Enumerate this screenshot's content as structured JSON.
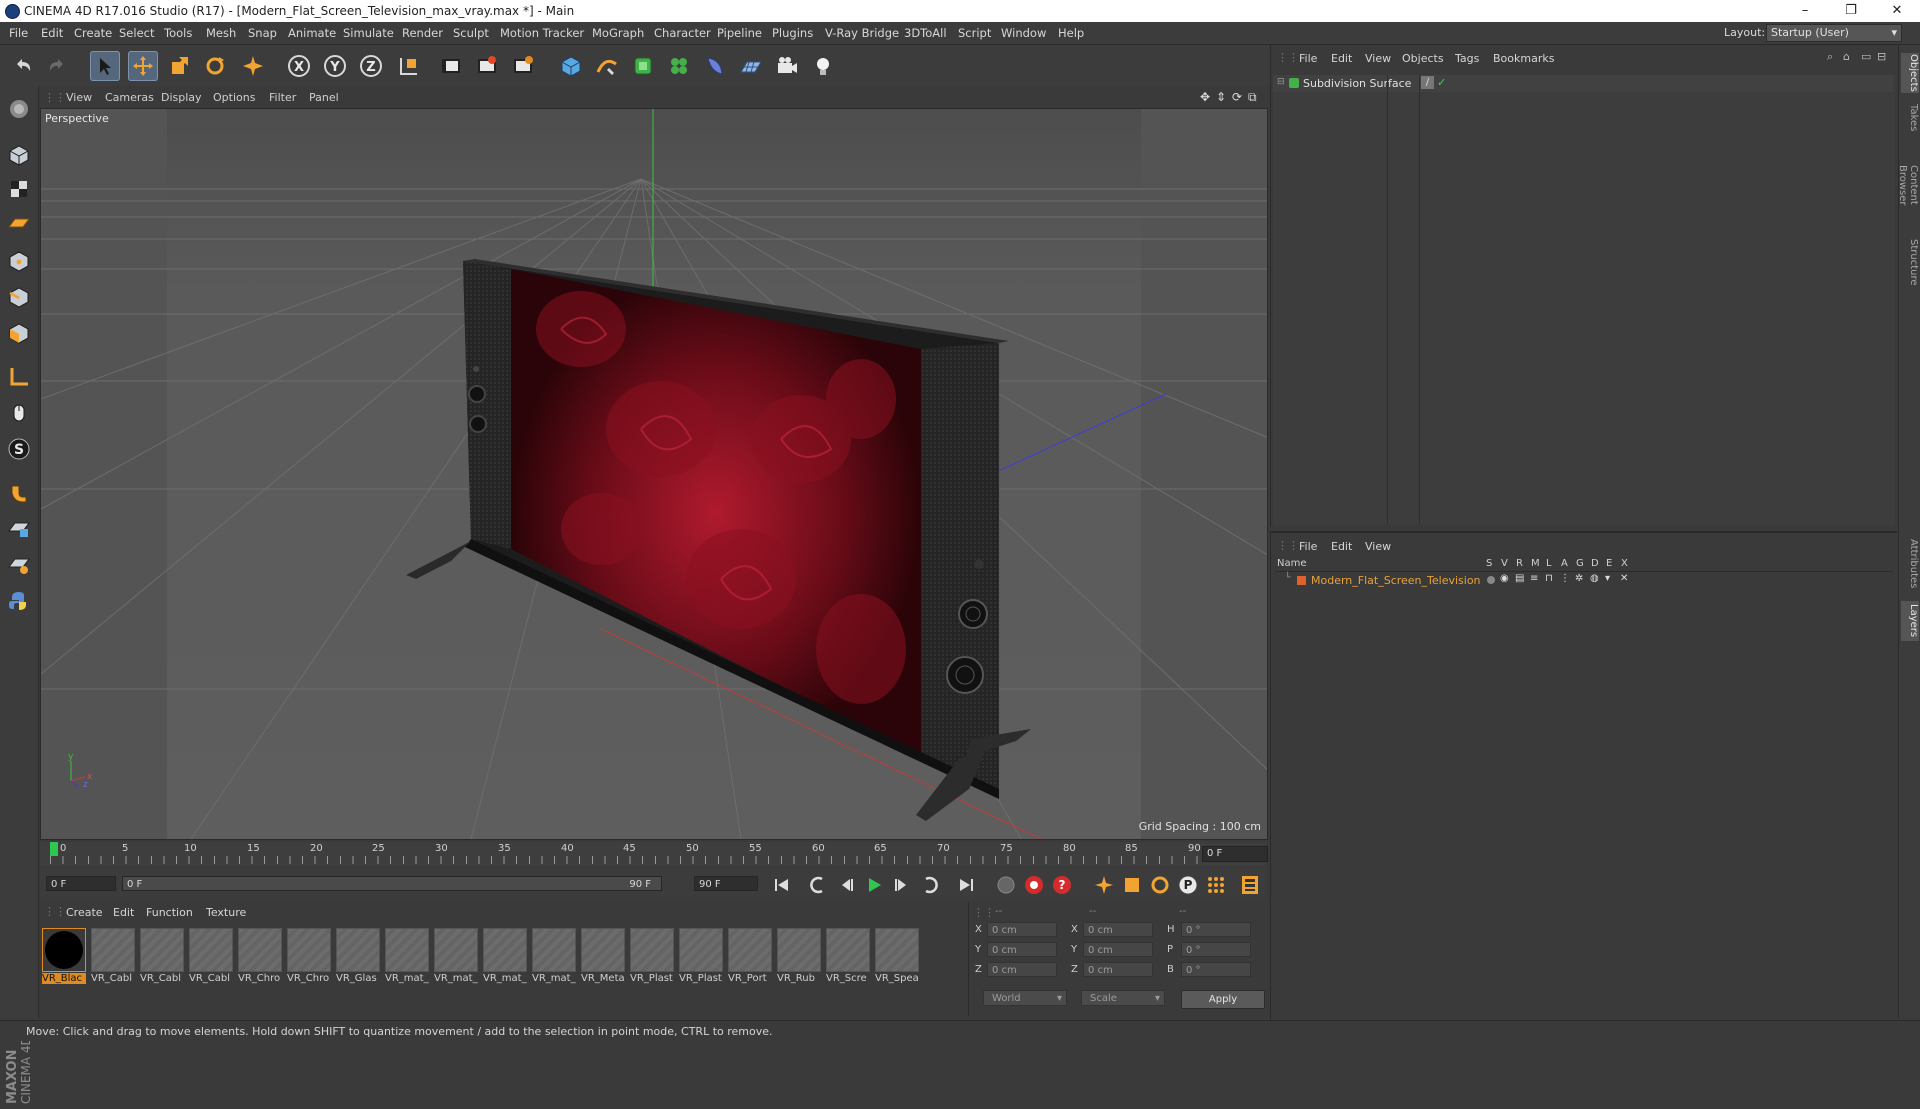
{
  "window": {
    "title": "CINEMA 4D R17.016 Studio (R17) - [Modern_Flat_Screen_Television_max_vray.max *] - Main",
    "controls": [
      "–",
      "❐",
      "✕"
    ]
  },
  "menu": [
    "File",
    "Edit",
    "Create",
    "Select",
    "Tools",
    "Mesh",
    "Snap",
    "Animate",
    "Simulate",
    "Render",
    "Sculpt",
    "Motion Tracker",
    "MoGraph",
    "Character",
    "Pipeline",
    "Plugins",
    "V-Ray Bridge",
    "3DToAll",
    "Script",
    "Window",
    "Help"
  ],
  "layout": {
    "label": "Layout:",
    "value": "Startup (User)"
  },
  "toolbar": {
    "icons": [
      "undo-icon",
      "redo-icon",
      "select-pointer-icon",
      "move-icon",
      "scale-icon",
      "rotate-icon",
      "live-select-icon",
      "x-axis-icon",
      "y-axis-icon",
      "z-axis-icon",
      "world-coordinates-icon",
      "render-view-icon",
      "render-picture-viewer-icon",
      "edit-render-settings-icon",
      "cube-icon",
      "pen-spline-icon",
      "subdivision-surface-icon",
      "cloner-icon",
      "deformer-icon",
      "floor-icon",
      "camera-icon",
      "light-icon"
    ],
    "axis_labels": [
      "X",
      "Y",
      "Z"
    ]
  },
  "viewport": {
    "menu": [
      "View",
      "Cameras",
      "Display",
      "Options",
      "Filter",
      "Panel"
    ],
    "label": "Perspective",
    "grid_spacing": "Grid Spacing : 100 cm",
    "axis_letters": [
      "y",
      "z",
      "x"
    ]
  },
  "timeline": {
    "ticks": [
      "0",
      "5",
      "10",
      "15",
      "20",
      "25",
      "30",
      "35",
      "40",
      "45",
      "50",
      "55",
      "60",
      "65",
      "70",
      "75",
      "80",
      "85",
      "90"
    ],
    "end_field": "0 F",
    "current_frame": "0 F",
    "range_start": "0 F",
    "range_end": "90 F",
    "max_field": "90 F"
  },
  "materials": {
    "menu": [
      "Create",
      "Edit",
      "Function",
      "Texture"
    ],
    "items": [
      "VR_Blac",
      "VR_Cabl",
      "VR_Cabl",
      "VR_Cabl",
      "VR_Chro",
      "VR_Chro",
      "VR_Glas",
      "VR_mat_",
      "VR_mat_",
      "VR_mat_",
      "VR_mat_",
      "VR_Meta",
      "VR_Plast",
      "VR_Plast",
      "VR_Port",
      "VR_Rub",
      "VR_Scre",
      "VR_Spea"
    ]
  },
  "coordinates": {
    "headers": [
      "--",
      "--",
      "--"
    ],
    "rows": [
      {
        "a": "X",
        "av": "0 cm",
        "b": "X",
        "bv": "0 cm",
        "c": "H",
        "cv": "0 °"
      },
      {
        "a": "Y",
        "av": "0 cm",
        "b": "Y",
        "bv": "0 cm",
        "c": "P",
        "cv": "0 °"
      },
      {
        "a": "Z",
        "av": "0 cm",
        "b": "Z",
        "bv": "0 cm",
        "c": "B",
        "cv": "0 °"
      }
    ],
    "mode": "World",
    "size_mode": "Scale",
    "apply": "Apply"
  },
  "objects_panel": {
    "menu": [
      "File",
      "Edit",
      "View",
      "Objects",
      "Tags",
      "Bookmarks"
    ],
    "items": [
      {
        "name": "Subdivision Surface"
      }
    ]
  },
  "layers_panel": {
    "menu": [
      "File",
      "Edit",
      "View"
    ],
    "columns": [
      "Name",
      "S",
      "V",
      "R",
      "M",
      "L",
      "A",
      "G",
      "D",
      "E",
      "X"
    ],
    "items": [
      {
        "name": "Modern_Flat_Screen_Television"
      }
    ]
  },
  "right_tabs": [
    "Objects",
    "Takes",
    "Content Browser",
    "Structure",
    "Attributes",
    "Layers"
  ],
  "logo": {
    "maxon": "MAXON",
    "product": "CINEMA 4D"
  },
  "status": "Move: Click and drag to move elements. Hold down SHIFT to quantize movement / add to the selection in point mode, CTRL to remove.",
  "colors": {
    "accent": "#e08a20",
    "selection": "#55677d",
    "background": "#3a3a3a",
    "viewport": "#5b5b5b"
  }
}
